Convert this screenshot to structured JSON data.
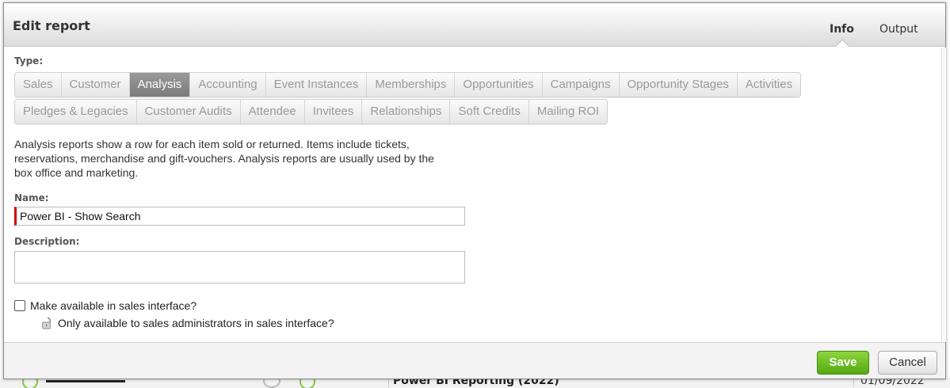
{
  "dialog": {
    "title": "Edit report",
    "tabs": [
      {
        "label": "Info",
        "active": true
      },
      {
        "label": "Output",
        "active": false
      }
    ]
  },
  "type_section": {
    "label": "Type:",
    "row1": [
      "Sales",
      "Customer",
      "Analysis",
      "Accounting",
      "Event Instances",
      "Memberships",
      "Opportunities",
      "Campaigns",
      "Opportunity Stages",
      "Activities"
    ],
    "row2": [
      "Pledges & Legacies",
      "Customer Audits",
      "Attendee",
      "Invitees",
      "Relationships",
      "Soft Credits",
      "Mailing ROI"
    ],
    "selected": "Analysis"
  },
  "description_text": "Analysis reports show a row for each item sold or returned. Items include tickets, reservations, merchandise and gift-vouchers. Analysis reports are usually used by the box office and marketing.",
  "name_field": {
    "label": "Name:",
    "value": "Power BI - Show Search"
  },
  "description_field": {
    "label": "Description:",
    "value": ""
  },
  "sales_interface": {
    "checkbox_label": "Make available in sales interface?",
    "checked": false,
    "sub_label": "Only available to sales administrators in sales interface?",
    "sub_icon": "lock-open-icon"
  },
  "footer": {
    "save_label": "Save",
    "cancel_label": "Cancel"
  },
  "background": {
    "title": "Power BI Reporting (2022)",
    "date": "01/09/2022"
  },
  "colors": {
    "accent_green": "#6cbf24",
    "active_tab_gray": "#8a8a8a",
    "required_red": "#d20000"
  }
}
